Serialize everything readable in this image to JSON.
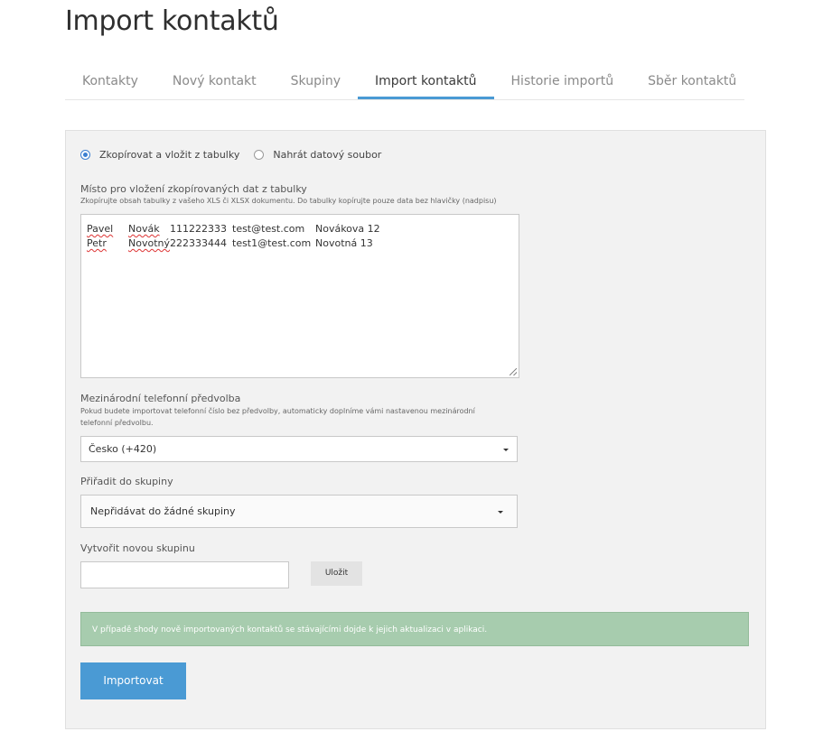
{
  "page": {
    "title": "Import kontaktů"
  },
  "tabs": [
    {
      "label": "Kontakty",
      "active": false
    },
    {
      "label": "Nový kontakt",
      "active": false
    },
    {
      "label": "Skupiny",
      "active": false
    },
    {
      "label": "Import kontaktů",
      "active": true
    },
    {
      "label": "Historie importů",
      "active": false
    },
    {
      "label": "Sběr kontaktů",
      "active": false
    }
  ],
  "import_mode": {
    "options": [
      {
        "label": "Zkopírovat a vložit z tabulky",
        "checked": true
      },
      {
        "label": "Nahrát datový soubor",
        "checked": false
      }
    ]
  },
  "paste_area": {
    "label": "Místo pro vložení zkopírovaných dat z tabulky",
    "hint": "Zkopírujte obsah tabulky z vašeho XLS či XLSX dokumentu. Do tabulky kopírujte pouze data bez hlavičky (nadpisu)",
    "rows": [
      [
        "Pavel",
        "Novák",
        "111222333",
        "test@test.com",
        "Novákova 12"
      ],
      [
        "Petr",
        "Novotný",
        "222333444",
        "test1@test.com",
        "Novotná 13"
      ]
    ]
  },
  "phone_prefix": {
    "label": "Mezinárodní telefonní předvolba",
    "hint_line1": "Pokud budete importovat telefonní číslo bez předvolby, automaticky doplníme vámi nastavenou mezinárodní",
    "hint_line2": "telefonní předvolbu.",
    "selected": "Česko (+420)"
  },
  "group": {
    "label": "Přiřadit do skupiny",
    "selected": "Nepřidávat do žádné skupiny"
  },
  "new_group": {
    "label": "Vytvořit novou skupinu",
    "value": "",
    "save_label": "Uložit"
  },
  "notice": {
    "text": "V případě shody nově importovaných kontaktů se stávajícími dojde k jejich aktualizaci v aplikaci.",
    "color": "#a7ccae"
  },
  "actions": {
    "import_label": "Importovat",
    "accent": "#4a9ad4"
  }
}
